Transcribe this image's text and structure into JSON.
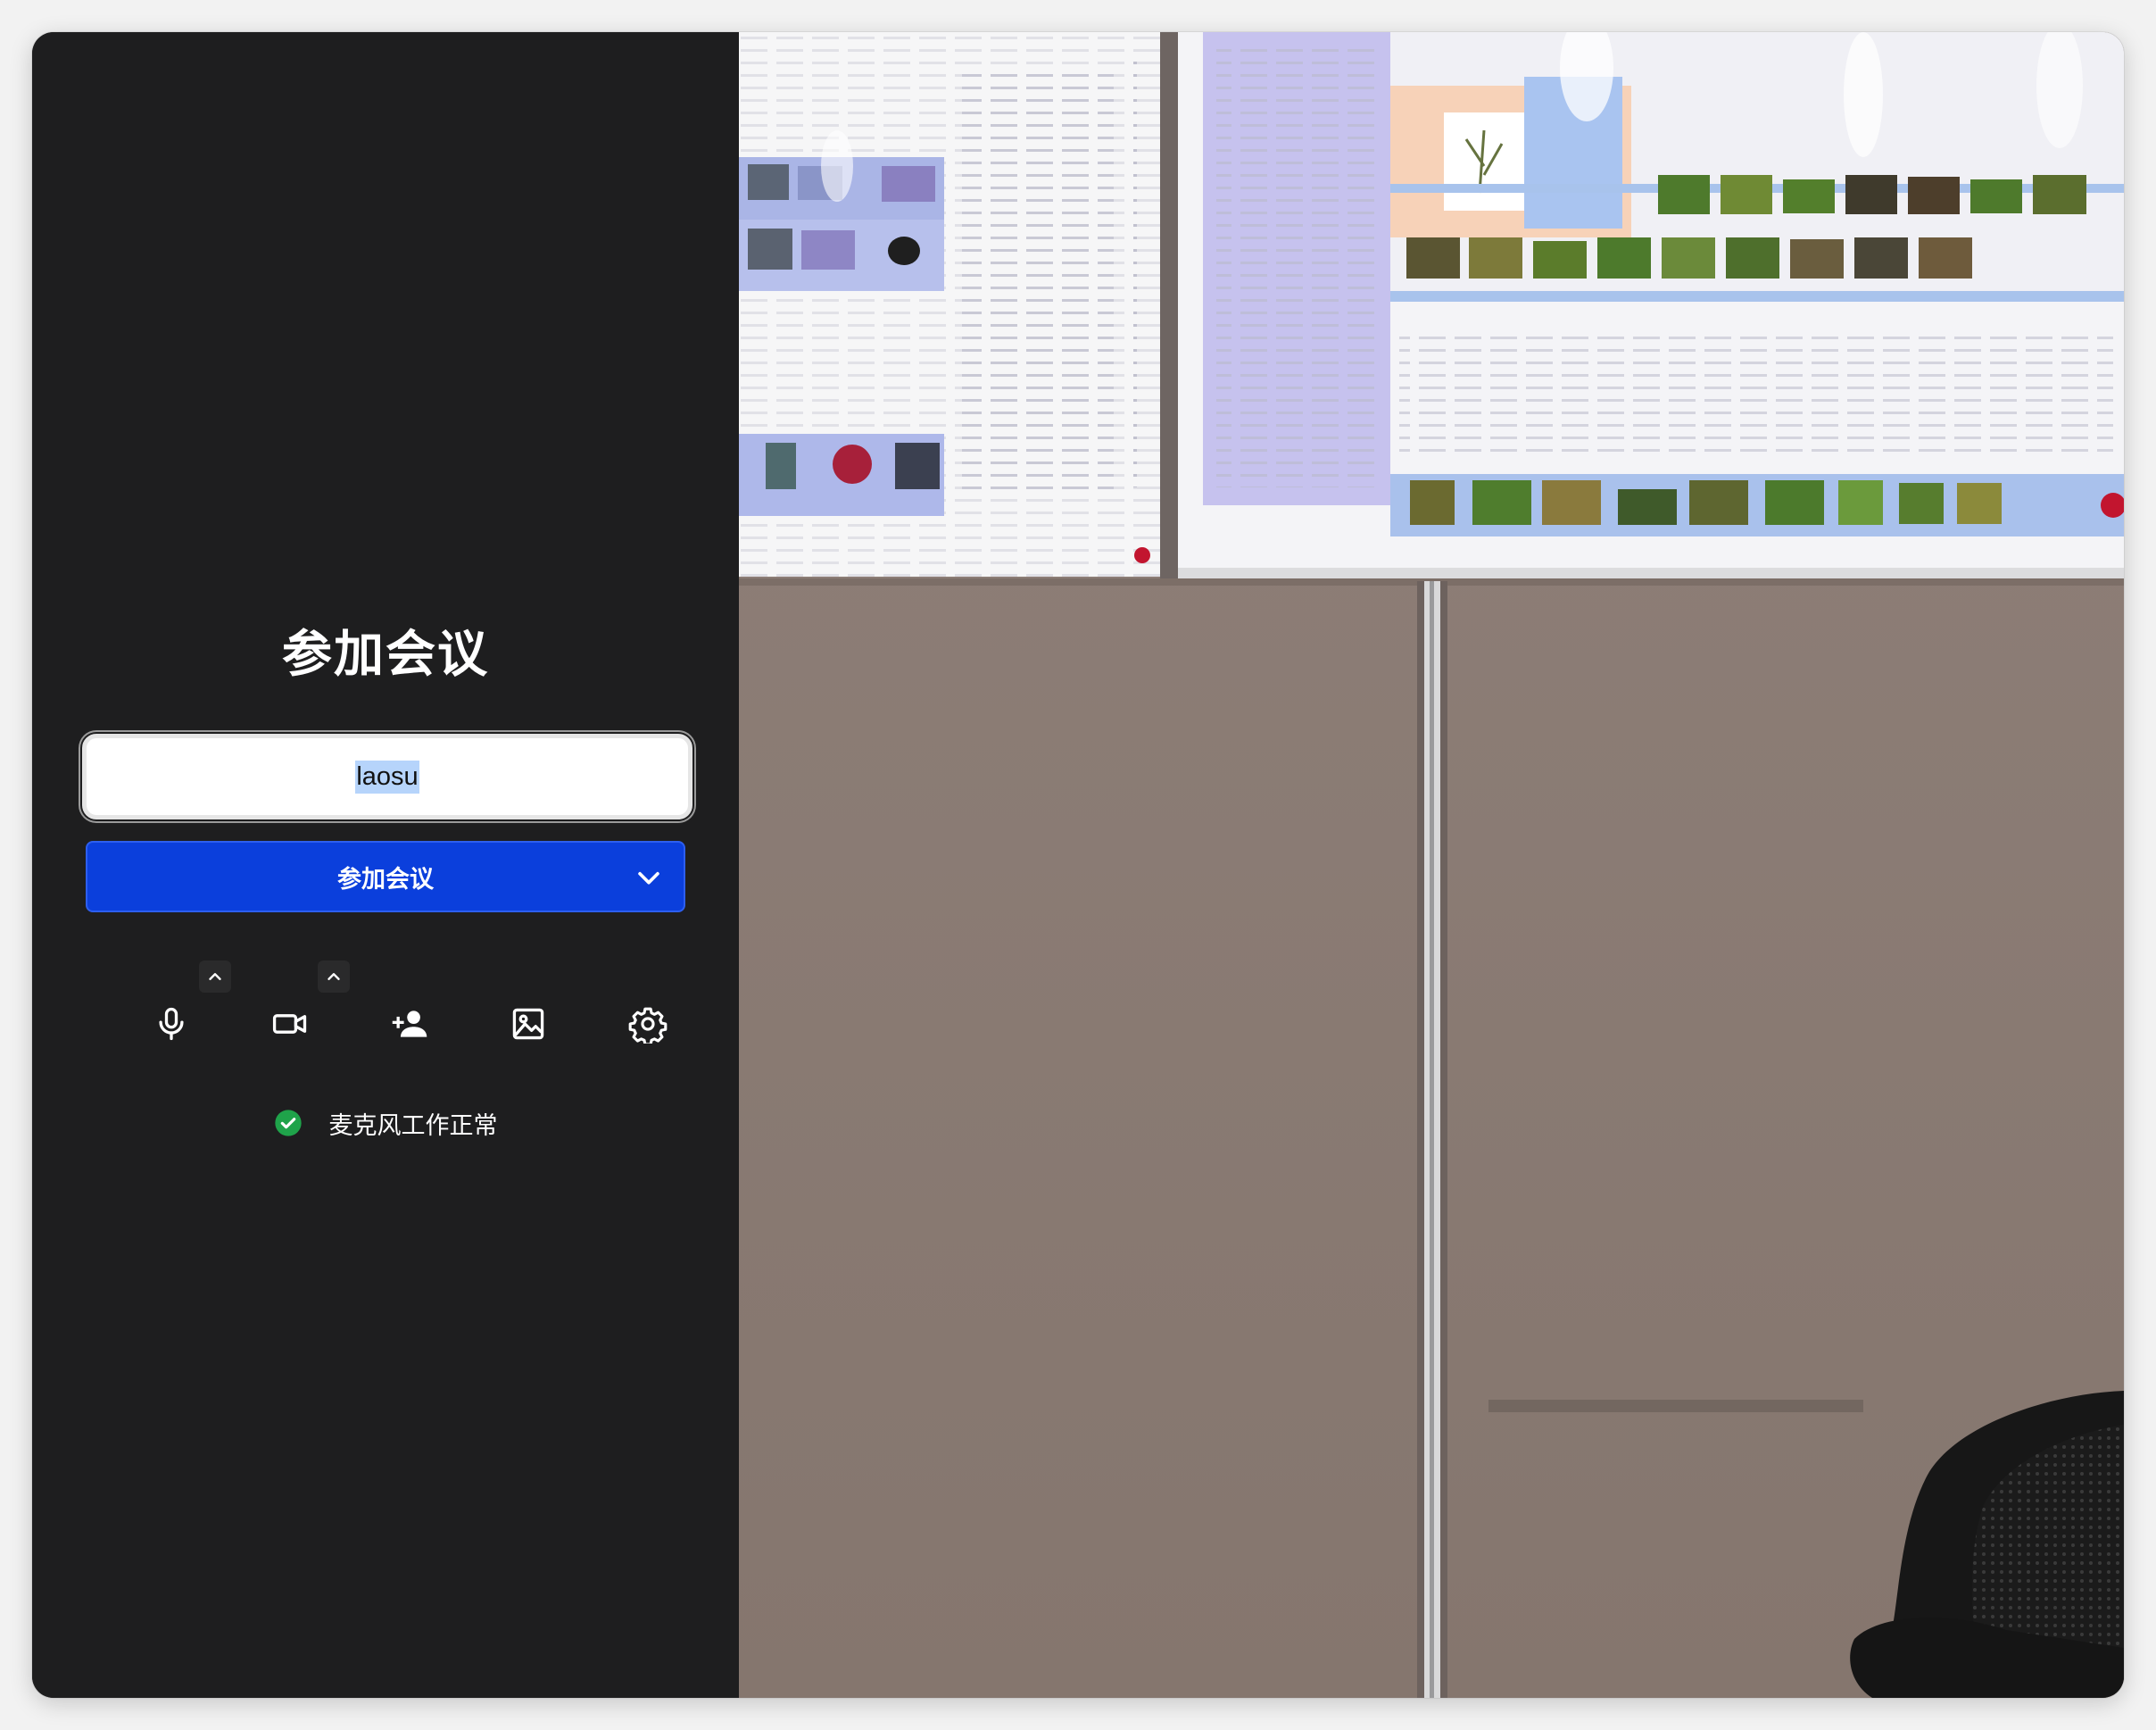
{
  "join": {
    "title": "参加会议",
    "name_value": "laosu",
    "join_button_label": "参加会议"
  },
  "toolbar": {
    "icons": [
      "microphone-icon",
      "camera-icon",
      "invite-person-icon",
      "background-image-icon",
      "settings-gear-icon"
    ]
  },
  "status": {
    "text": "麦克风工作正常",
    "icon": "check-circle-icon",
    "color": "#1fa34a"
  },
  "colors": {
    "panel_bg": "#1e1e1f",
    "accent": "#0b3fdc"
  }
}
